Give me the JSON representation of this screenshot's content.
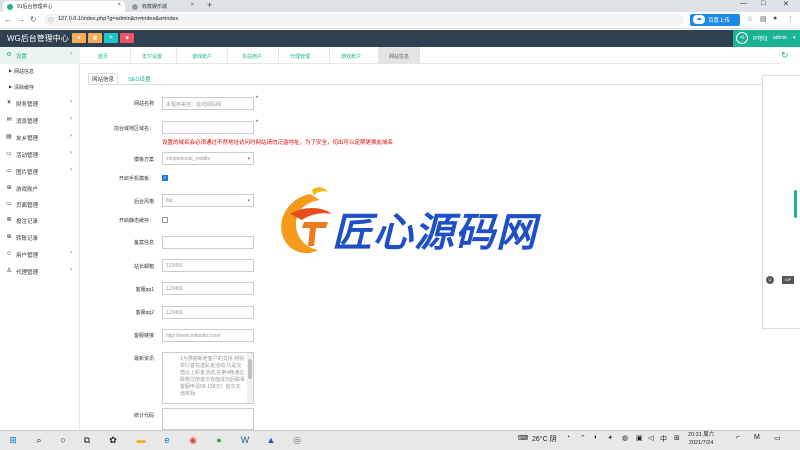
{
  "browser": {
    "tabs": [
      {
        "title": "91后台管理中心"
      },
      {
        "title": "收款娱乐城"
      }
    ],
    "url": "127.0.0.1/index.php?g=admin&m=index&a=index",
    "baidu_button": "百度上传"
  },
  "header": {
    "brand": "WG后台管理中心",
    "user_label": "IP地址",
    "username": "admin"
  },
  "sidebar": {
    "items": [
      {
        "label": "设置",
        "icon": "gear-icon"
      },
      {
        "label": "网站信息",
        "sub": true
      },
      {
        "label": "清除缓存",
        "sub": true
      },
      {
        "label": "财务管理",
        "icon": "yen-icon"
      },
      {
        "label": "消息管理",
        "icon": "message-icon"
      },
      {
        "label": "友乡管理",
        "icon": "table-icon"
      },
      {
        "label": "活动管理",
        "icon": "monitor-icon"
      },
      {
        "label": "图片管理",
        "icon": "monitor-icon"
      },
      {
        "label": "游戏账户",
        "icon": "gamepad-icon"
      },
      {
        "label": "页面管理",
        "icon": "monitor-icon"
      },
      {
        "label": "投注记录",
        "icon": "list-icon"
      },
      {
        "label": "转账记录",
        "icon": "gamepad-icon"
      },
      {
        "label": "用户管理",
        "icon": "users-icon"
      },
      {
        "label": "代理管理",
        "icon": "user-icon"
      }
    ]
  },
  "navtabs": [
    "首页",
    "支付设置",
    "游戏账户",
    "本站用户",
    "代理管理",
    "游戏账户",
    "网站信息"
  ],
  "subtabs": [
    "网站信息",
    "SEO设置"
  ],
  "form": {
    "site_name_label": "网站名称",
    "site_name_placeholder": "本程序来自：蓝线源码网",
    "domain_label": "前台域地区域名：",
    "notice": "设置的域名会必须通过不然地址访问时网站请勿泛滥地址，为了安全，切出可以定期更换此域名",
    "template_label": "模板方案",
    "template_value": "simpleboots_mobile",
    "mobile_tpl_label": "开启手机模板：",
    "style_label": "后台风格",
    "style_value": "flat",
    "static_label": "开启静态缓存：",
    "record_label": "备案信息",
    "email_label": "站长邮箱",
    "email_value": "123456",
    "qq1_label": "客服qq1",
    "qq1_value": "123456",
    "qq2_label": "客服qq2",
    "qq2_value": "123456",
    "link_label": "客服链接",
    "link_value": "http://www.mitaobo.com/",
    "news_label": "最新资讯",
    "news_value": "1为感谢新老客户的支持,特别举行首充送彩金活动.凡是充值以上彩金活动,在第4晚通过联络注册首次充值成功后联系客服申请58-158元！首次充值奖励",
    "stats_label": "统计代码"
  },
  "watermark": {
    "text": "匠心源码网"
  },
  "taskbar": {
    "weather": "26°C 阴",
    "ime": "中",
    "time": "20:31 周六",
    "date": "2021/7/24"
  },
  "colors": {
    "accent": "#1ab394",
    "header": "#2f4050",
    "notice": "#e60000"
  }
}
